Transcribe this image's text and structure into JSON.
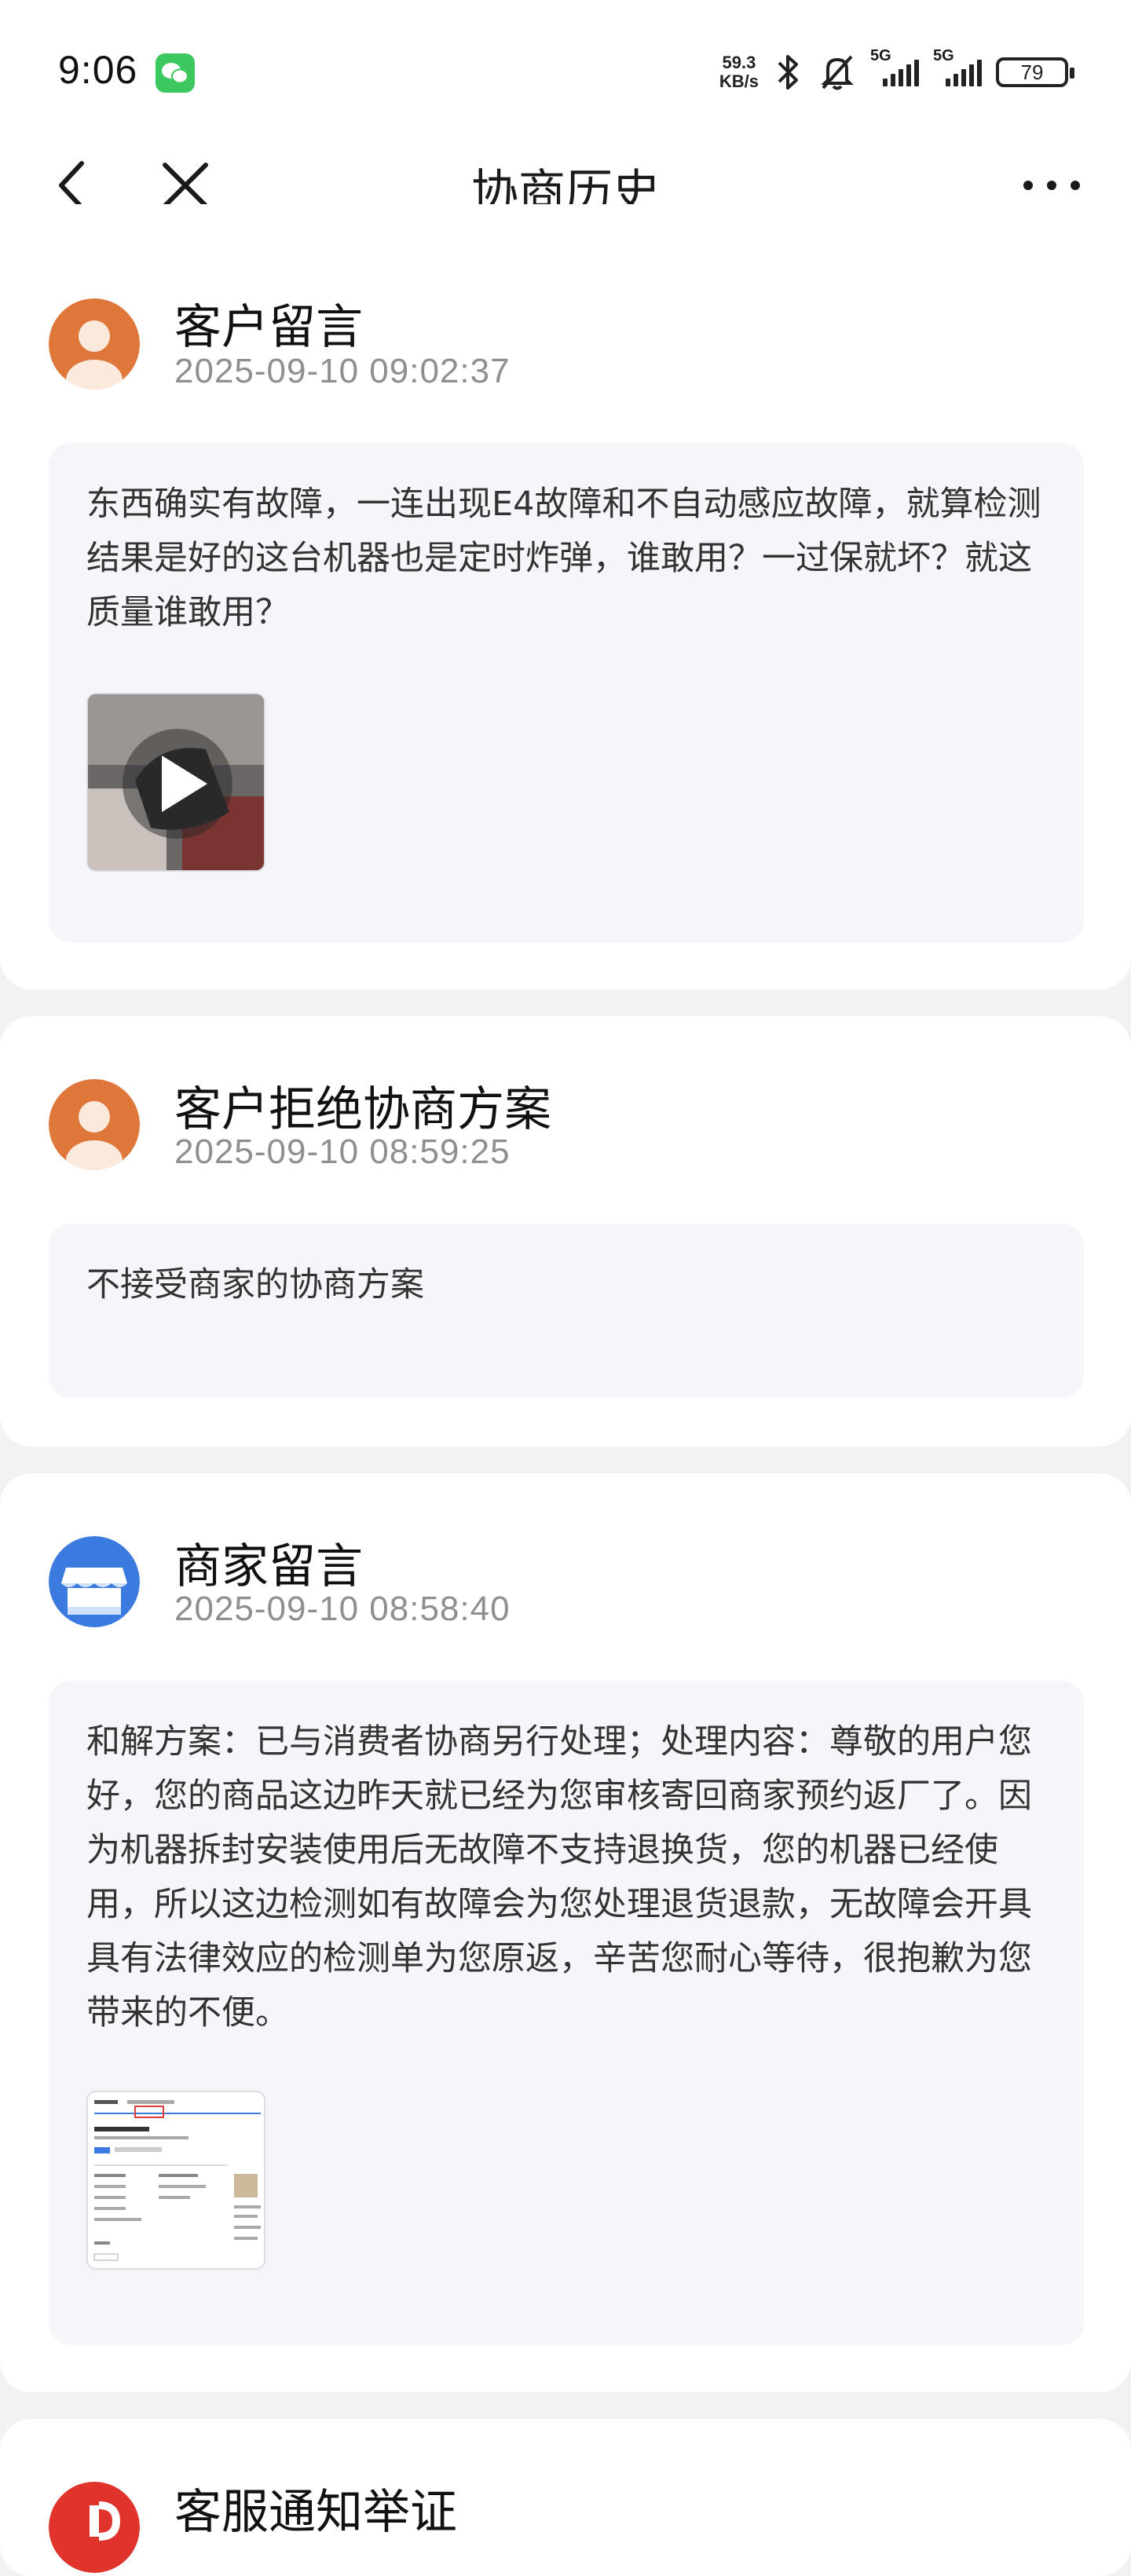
{
  "status_bar": {
    "time": "9:06",
    "net_speed_value": "59.3",
    "net_speed_unit": "KB/s",
    "signal1_label": "5G",
    "signal2_label": "5G",
    "battery": "79"
  },
  "nav": {
    "title": "协商历史"
  },
  "entries": [
    {
      "title": "客户留言",
      "time": "2025-09-10 09:02:37",
      "message": "东西确实有故障，一连出现E4故障和不自动感应故障，就算检测结果是好的这台机器也是定时炸弹，谁敢用？一过保就坏？就这质量谁敢用？",
      "avatar": "user-avatar",
      "attachment": "video"
    },
    {
      "title": "客户拒绝协商方案",
      "time": "2025-09-10 08:59:25",
      "message": "不接受商家的协商方案",
      "avatar": "user-avatar"
    },
    {
      "title": "商家留言",
      "time": "2025-09-10 08:58:40",
      "message": "和解方案：已与消费者协商另行处理；处理内容：尊敬的用户您好，您的商品这边昨天就已经为您审核寄回商家预约返厂了。因为机器拆封安装使用后无故障不支持退换货，您的机器已经使用，所以这边检测如有故障会为您处理退货退款，无故障会开具具有法律效应的检测单为您原返，辛苦您耐心等待，很抱歉为您带来的不便。",
      "avatar": "store-avatar",
      "attachment": "image"
    },
    {
      "title": "客服通知举证",
      "avatar": "service-avatar"
    }
  ],
  "colors": {
    "user_avatar": "#e0773a",
    "store_avatar": "#3b7be0",
    "service_avatar": "#e0332c",
    "card_bg": "#ffffff",
    "message_bg": "#f5f6fa",
    "page_bg": "#f2f2f5"
  }
}
